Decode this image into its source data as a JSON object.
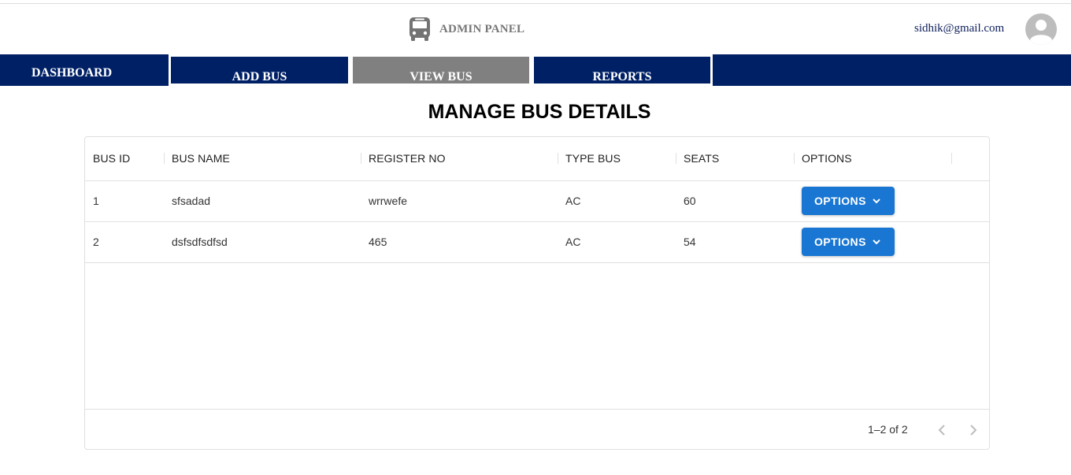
{
  "header": {
    "app_title": "ADMIN PANEL",
    "brand_icon": "bus-icon",
    "user_email": "sidhik@gmail.com",
    "avatar_icon": "person-icon"
  },
  "nav": {
    "items": [
      {
        "label": "DASHBOARD",
        "active": false
      },
      {
        "label": "ADD BUS",
        "active": false
      },
      {
        "label": "VIEW BUS",
        "active": true
      },
      {
        "label": "REPORTS",
        "active": false
      }
    ],
    "colors": {
      "bar": "#002066",
      "active": "#808080",
      "text": "#ffffff"
    }
  },
  "main": {
    "title": "MANAGE BUS DETAILS",
    "table": {
      "columns": [
        "BUS ID",
        "BUS NAME",
        "REGISTER NO",
        "TYPE BUS",
        "SEATS",
        "OPTIONS"
      ],
      "rows": [
        {
          "bus_id": "1",
          "bus_name": "sfsadad",
          "register_no": "wrrwefe",
          "type_bus": "AC",
          "seats": "60",
          "options_label": "OPTIONS"
        },
        {
          "bus_id": "2",
          "bus_name": "dsfsdfsdfsd",
          "register_no": "465",
          "type_bus": "AC",
          "seats": "54",
          "options_label": "OPTIONS"
        }
      ],
      "pagination": {
        "text": "1–2 of 2",
        "prev_icon": "chevron-left-icon",
        "next_icon": "chevron-right-icon"
      },
      "button_color": "#1976d2"
    }
  }
}
